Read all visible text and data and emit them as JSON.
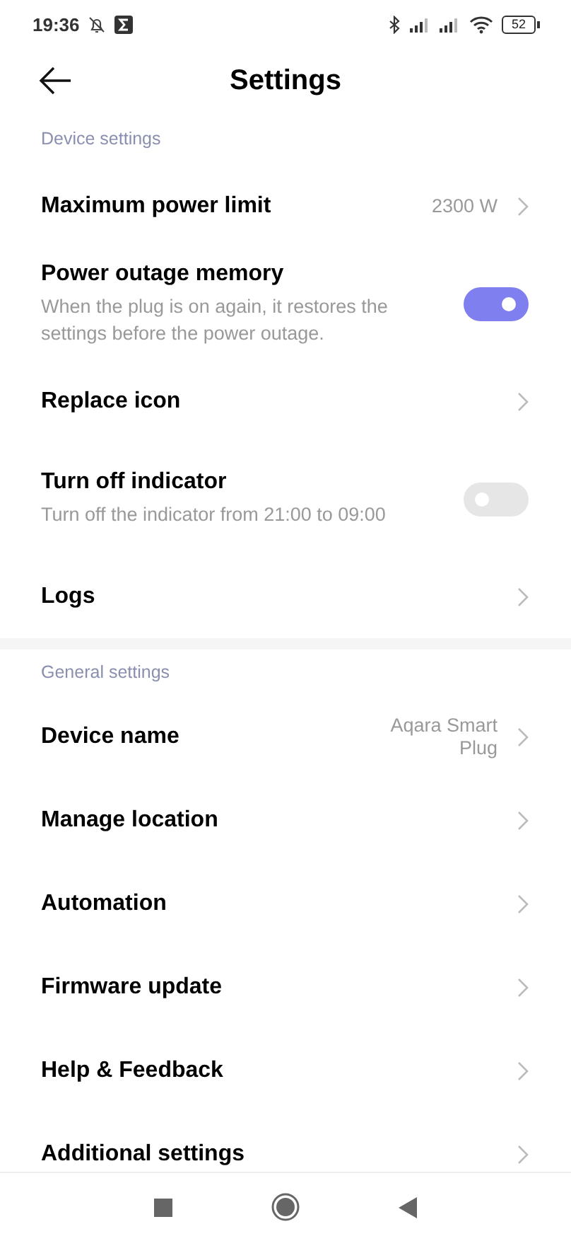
{
  "status_bar": {
    "time": "19:36",
    "battery": "52"
  },
  "header": {
    "title": "Settings"
  },
  "sections": [
    {
      "title": "Device settings",
      "items": [
        {
          "kind": "link",
          "title": "Maximum power limit",
          "value": "2300 W"
        },
        {
          "kind": "toggle",
          "title": "Power outage memory",
          "subtitle": "When the plug is on again, it restores the settings before the power outage.",
          "on": true
        },
        {
          "kind": "link",
          "title": "Replace icon"
        },
        {
          "kind": "toggle",
          "title": "Turn off indicator",
          "subtitle": "Turn off the indicator from 21:00 to 09:00",
          "on": false
        },
        {
          "kind": "link",
          "title": "Logs"
        }
      ]
    },
    {
      "title": "General settings",
      "items": [
        {
          "kind": "link",
          "title": "Device name",
          "value": "Aqara Smart Plug"
        },
        {
          "kind": "link",
          "title": "Manage location"
        },
        {
          "kind": "link",
          "title": "Automation"
        },
        {
          "kind": "link",
          "title": "Firmware update"
        },
        {
          "kind": "link",
          "title": "Help & Feedback"
        },
        {
          "kind": "link",
          "title": "Additional settings"
        }
      ]
    }
  ]
}
